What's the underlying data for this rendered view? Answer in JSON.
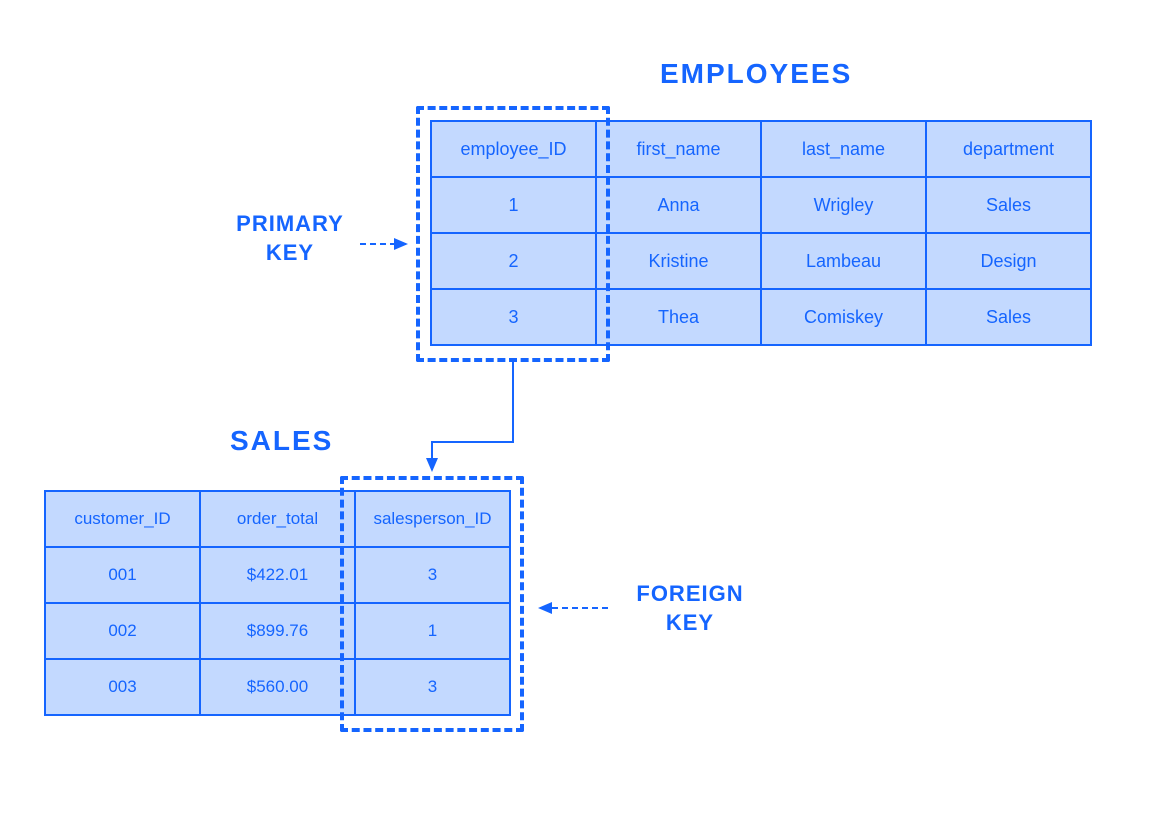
{
  "colors": {
    "primary": "#1565ff",
    "cellBg": "#c3d9ff"
  },
  "employees": {
    "title": "EMPLOYEES",
    "headers": [
      "employee_ID",
      "first_name",
      "last_name",
      "department"
    ],
    "rows": [
      [
        "1",
        "Anna",
        "Wrigley",
        "Sales"
      ],
      [
        "2",
        "Kristine",
        "Lambeau",
        "Design"
      ],
      [
        "3",
        "Thea",
        "Comiskey",
        "Sales"
      ]
    ]
  },
  "sales": {
    "title": "SALES",
    "headers": [
      "customer_ID",
      "order_total",
      "salesperson_ID"
    ],
    "rows": [
      [
        "001",
        "$422.01",
        "3"
      ],
      [
        "002",
        "$899.76",
        "1"
      ],
      [
        "003",
        "$560.00",
        "3"
      ]
    ]
  },
  "labels": {
    "primaryKey": "PRIMARY\nKEY",
    "foreignKey": "FOREIGN\nKEY"
  }
}
